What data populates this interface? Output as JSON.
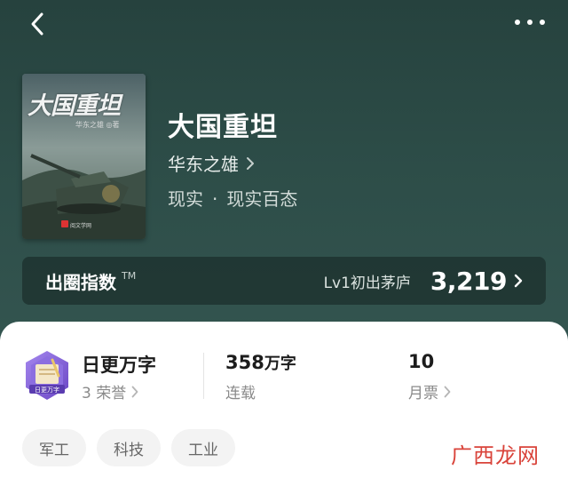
{
  "book": {
    "title": "大国重坦",
    "author": "华东之雄",
    "genre_main": "现实",
    "genre_separator": "·",
    "genre_sub": "现实百态",
    "cover": {
      "title": "大国重坦",
      "subtitle": "华东之雄 ◎著",
      "publisher": "阅文学网"
    }
  },
  "index_bar": {
    "label": "出圈指数",
    "trademark": "TM",
    "level": "Lv1初出茅庐",
    "score": "3,219"
  },
  "stats": {
    "honor": {
      "title": "日更万字",
      "sub": "3 荣誉",
      "badge_text": "日更万字"
    },
    "words": {
      "value": "358",
      "unit": "万字",
      "sub": "连载"
    },
    "tickets": {
      "value": "10",
      "sub": "月票"
    }
  },
  "tags": [
    "军工",
    "科技",
    "工业"
  ],
  "watermark": "广西龙网",
  "icons": {
    "back": "back-arrow-icon",
    "more": "more-dots-icon",
    "chevron": "chevron-right-icon"
  },
  "colors": {
    "header_bg": "#2d4d48",
    "watermark": "#d9433a",
    "honor_purple": "#7a5bd0"
  }
}
